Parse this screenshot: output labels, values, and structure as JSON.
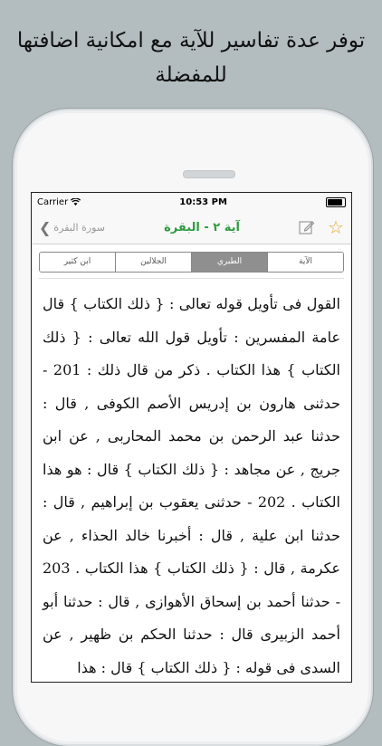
{
  "headline": "توفر عدة تفاسير للآية مع امكانية اضافتها للمفضلة",
  "status": {
    "carrier": "Carrier",
    "time": "10:53 PM"
  },
  "nav": {
    "back_label": "سورة البقرة",
    "title": "آية ٢ - البقرة",
    "star_icon": "star-icon",
    "edit_icon": "edit-icon"
  },
  "tabs": [
    "ابن كثير",
    "الجلالين",
    "الطبري",
    "الآية"
  ],
  "active_tab": "الطبري",
  "tafsir_text": "القول فى تأويل قوله تعالى : { ذلك الكتاب } قال عامة المفسرين : تأويل قول الله تعالى : { ذلك الكتاب } هذا الكتاب . ذكر من قال ذلك : 201 - حدثنى هارون بن إدريس الأصم الكوفى , قال : حدثنا عبد الرحمن بن محمد المحاربى , عن ابن جريج , عن مجاهد : { ذلك الكتاب } قال : هو هذا الكتاب . 202 - حدثنى يعقوب بن إبراهيم , قال : حدثنا ابن علية , قال : أخبرنا خالد الحذاء , عن عكرمة , قال : { ذلك الكتاب } هذا الكتاب . 203 - حدثنا أحمد بن إسحاق الأهوازى , قال : حدثنا أبو أحمد الزبيرى قال : حدثنا الحكم بن ظهير , عن السدى فى قوله : { ذلك الكتاب } قال : هذا"
}
